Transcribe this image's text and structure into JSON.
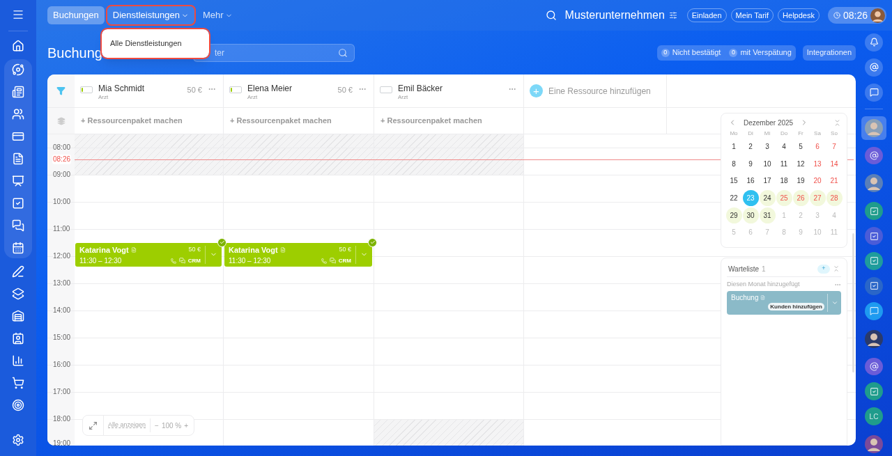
{
  "topbar": {
    "tabs": [
      {
        "label": "Buchungen",
        "selected": true,
        "caret": false,
        "highlighted": false
      },
      {
        "label": "Dienstleistungen",
        "selected": false,
        "caret": true,
        "highlighted": true
      },
      {
        "label": "Mehr",
        "selected": false,
        "caret": true,
        "highlighted": false
      }
    ],
    "company": "Musterunternehmen",
    "buttons": [
      "Einladen",
      "Mein Tarif",
      "Helpdesk"
    ],
    "clock": "08:26"
  },
  "dropdown": {
    "highlighted": true,
    "items": [
      {
        "label": "Alle Dienstleistungen"
      }
    ]
  },
  "page": {
    "title": "Buchung",
    "search": {
      "placeholder": "ter"
    },
    "counters": [
      {
        "count": "0",
        "label": "Nicht bestätigt"
      },
      {
        "count": "0",
        "label": "mit Verspätung"
      }
    ],
    "integrations": "Integrationen"
  },
  "resources": [
    {
      "name": "Mia Schmidt",
      "role": "Arzt",
      "price": "50 €",
      "level": 0.15,
      "package": "+ Ressourcenpaket machen",
      "evening_off": false
    },
    {
      "name": "Elena Meier",
      "role": "Arzt",
      "price": "50 €",
      "level": 0.15,
      "package": "+ Ressourcenpaket machen",
      "evening_off": false
    },
    {
      "name": "Emil Bäcker",
      "role": "Arzt",
      "level": 0,
      "package": "+ Ressourcenpaket machen",
      "evening_off": true
    }
  ],
  "add_resource": {
    "icon": "+",
    "label": "Eine Ressource hinzufügen"
  },
  "schedule": {
    "hours": [
      "08:00",
      "09:00",
      "10:00",
      "11:00",
      "12:00",
      "13:00",
      "14:00",
      "15:00",
      "16:00",
      "17:00",
      "18:00",
      "19:00"
    ],
    "now": "08:26",
    "bookings": [
      [
        {
          "client": "Katarina Vogt",
          "price": "50 €",
          "time": "11:30 – 12:30",
          "badge": "CRM",
          "confirmed": true
        }
      ],
      [
        {
          "client": "Katarina Vogt",
          "price": "50 €",
          "time": "11:30 – 12:30",
          "badge": "CRM",
          "confirmed": true
        }
      ]
    ]
  },
  "zoom": {
    "show_all": "Alle anzeigen",
    "minus": "−",
    "level": "100 %",
    "plus": "+"
  },
  "calendar": {
    "month": "Dezember 2025",
    "weekdays": [
      "Mo",
      "Di",
      "Mi",
      "Do",
      "Fr",
      "Sa",
      "So"
    ],
    "weeks": [
      [
        {
          "d": "1",
          "weekend": false,
          "muted": false,
          "selected": false,
          "marked": false
        },
        {
          "d": "2",
          "weekend": false,
          "muted": false,
          "selected": false,
          "marked": false
        },
        {
          "d": "3",
          "weekend": false,
          "muted": false,
          "selected": false,
          "marked": false
        },
        {
          "d": "4",
          "weekend": false,
          "muted": false,
          "selected": false,
          "marked": false
        },
        {
          "d": "5",
          "weekend": false,
          "muted": false,
          "selected": false,
          "marked": false
        },
        {
          "d": "6",
          "weekend": true,
          "muted": false,
          "selected": false,
          "marked": false
        },
        {
          "d": "7",
          "weekend": true,
          "muted": false,
          "selected": false,
          "marked": false
        }
      ],
      [
        {
          "d": "8",
          "weekend": false,
          "muted": false,
          "selected": false,
          "marked": false
        },
        {
          "d": "9",
          "weekend": false,
          "muted": false,
          "selected": false,
          "marked": false
        },
        {
          "d": "10",
          "weekend": false,
          "muted": false,
          "selected": false,
          "marked": false
        },
        {
          "d": "11",
          "weekend": false,
          "muted": false,
          "selected": false,
          "marked": false
        },
        {
          "d": "12",
          "weekend": false,
          "muted": false,
          "selected": false,
          "marked": false
        },
        {
          "d": "13",
          "weekend": true,
          "muted": false,
          "selected": false,
          "marked": false
        },
        {
          "d": "14",
          "weekend": true,
          "muted": false,
          "selected": false,
          "marked": false
        }
      ],
      [
        {
          "d": "15",
          "weekend": false,
          "muted": false,
          "selected": false,
          "marked": false
        },
        {
          "d": "16",
          "weekend": false,
          "muted": false,
          "selected": false,
          "marked": false
        },
        {
          "d": "17",
          "weekend": false,
          "muted": false,
          "selected": false,
          "marked": false
        },
        {
          "d": "18",
          "weekend": false,
          "muted": false,
          "selected": false,
          "marked": false
        },
        {
          "d": "19",
          "weekend": false,
          "muted": false,
          "selected": false,
          "marked": false
        },
        {
          "d": "20",
          "weekend": true,
          "muted": false,
          "selected": false,
          "marked": false
        },
        {
          "d": "21",
          "weekend": true,
          "muted": false,
          "selected": false,
          "marked": false
        }
      ],
      [
        {
          "d": "22",
          "weekend": false,
          "muted": false,
          "selected": false,
          "marked": false
        },
        {
          "d": "23",
          "selected": true
        },
        {
          "d": "24",
          "weekend": false,
          "muted": false,
          "selected": false,
          "marked": true
        },
        {
          "d": "25",
          "weekend": true,
          "muted": false,
          "selected": false,
          "marked": true
        },
        {
          "d": "26",
          "weekend": true,
          "muted": false,
          "selected": false,
          "marked": true
        },
        {
          "d": "27",
          "weekend": true,
          "muted": false,
          "selected": false,
          "marked": true
        },
        {
          "d": "28",
          "weekend": true,
          "muted": false,
          "selected": false,
          "marked": true
        }
      ],
      [
        {
          "d": "29",
          "weekend": false,
          "muted": false,
          "selected": false,
          "marked": true
        },
        {
          "d": "30",
          "weekend": false,
          "muted": false,
          "selected": false,
          "marked": true
        },
        {
          "d": "31",
          "weekend": false,
          "muted": false,
          "selected": false,
          "marked": true
        },
        {
          "d": "1",
          "muted": true,
          "selected": false,
          "marked": false
        },
        {
          "d": "2",
          "muted": true,
          "selected": false,
          "marked": false
        },
        {
          "d": "3",
          "muted": true,
          "selected": false,
          "marked": false
        },
        {
          "d": "4",
          "muted": true,
          "selected": false,
          "marked": false
        }
      ],
      [
        {
          "d": "5",
          "muted": true,
          "selected": false,
          "marked": false
        },
        {
          "d": "6",
          "muted": true,
          "selected": false,
          "marked": false
        },
        {
          "d": "7",
          "muted": true,
          "selected": false,
          "marked": false
        },
        {
          "d": "8",
          "muted": true,
          "selected": false,
          "marked": false
        },
        {
          "d": "9",
          "muted": true,
          "selected": false,
          "marked": false
        },
        {
          "d": "10",
          "muted": true,
          "selected": false,
          "marked": false
        },
        {
          "d": "11",
          "muted": true,
          "selected": false,
          "marked": false
        }
      ]
    ]
  },
  "waitlist": {
    "title": "Warteliste",
    "count": "1",
    "add": "+",
    "group": "Diesen Monat hinzugefügt",
    "items": [
      {
        "title": "Buchung",
        "action": "Kunden hinzufügen"
      }
    ]
  },
  "right_rail": [
    {
      "kind": "bell"
    },
    {
      "kind": "at"
    },
    {
      "kind": "chat"
    },
    {
      "kind": "avatar",
      "selected": true,
      "color": "#8aa0b8"
    },
    {
      "kind": "at",
      "color": "#6a5cd8"
    },
    {
      "kind": "avatar",
      "selected": false,
      "color": "#5a7fb8"
    },
    {
      "kind": "task",
      "color": "#1f9c8c"
    },
    {
      "kind": "task",
      "color": "#4a5cd8"
    },
    {
      "kind": "task",
      "color": "#1f9c9c"
    },
    {
      "kind": "task",
      "color": "#2a66c8"
    },
    {
      "kind": "chat",
      "color": "#1e9af0"
    },
    {
      "kind": "avatar",
      "selected": false,
      "color": "#2a3a6a"
    },
    {
      "kind": "at",
      "color": "#6a5cd8"
    },
    {
      "kind": "task",
      "color": "#1f9c8c"
    },
    {
      "kind": "initials",
      "label": "LC",
      "color": "#1f9c8c"
    },
    {
      "kind": "avatar",
      "selected": false,
      "color": "#7a4a9a"
    }
  ]
}
